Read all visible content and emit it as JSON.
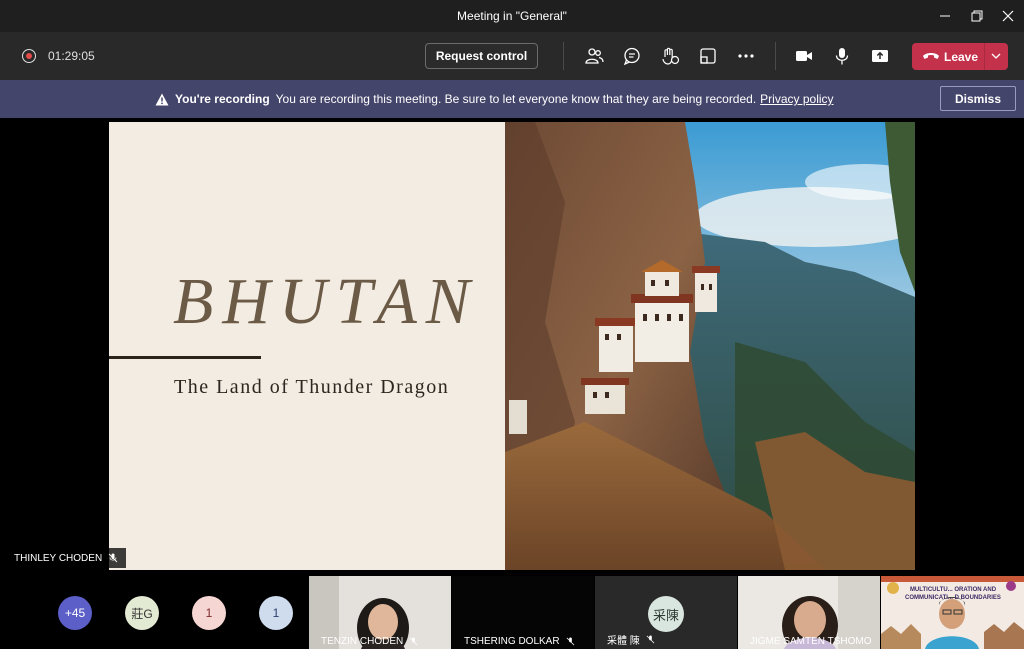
{
  "window": {
    "title": "Meeting in \"General\""
  },
  "toolbar": {
    "timer": "01:29:05",
    "request_control_label": "Request control",
    "leave_label": "Leave"
  },
  "banner": {
    "heading": "You're recording",
    "message": "You are recording this meeting. Be sure to let everyone know that they are being recorded.",
    "link": "Privacy policy",
    "dismiss_label": "Dismiss"
  },
  "slide": {
    "title": "BHUTAN",
    "subtitle": "The Land of Thunder Dragon"
  },
  "speaker": {
    "name": "THINLEY CHODEN"
  },
  "participants": {
    "overflow_count": "+45",
    "bubbles": [
      {
        "label": "莊G",
        "color": "#e3ead3"
      },
      {
        "label": "1",
        "color": "#f6d6d2"
      },
      {
        "label": "1",
        "color": "#cfdcee"
      }
    ],
    "tiles": [
      {
        "name": "TENZIN CHODEN"
      },
      {
        "name": "TSHERING DOLKAR"
      },
      {
        "name": "采體 陳",
        "initials": "采陳"
      },
      {
        "name": "JIGME SAMTEN TSHOMO"
      }
    ],
    "poster_title": "MULTICULTU... ORATION AND COMMUNICATI... D BOUNDARIES"
  },
  "colors": {
    "banner": "#44456b",
    "leave": "#c4314b",
    "overflow_bubble": "#5b5fc7"
  }
}
